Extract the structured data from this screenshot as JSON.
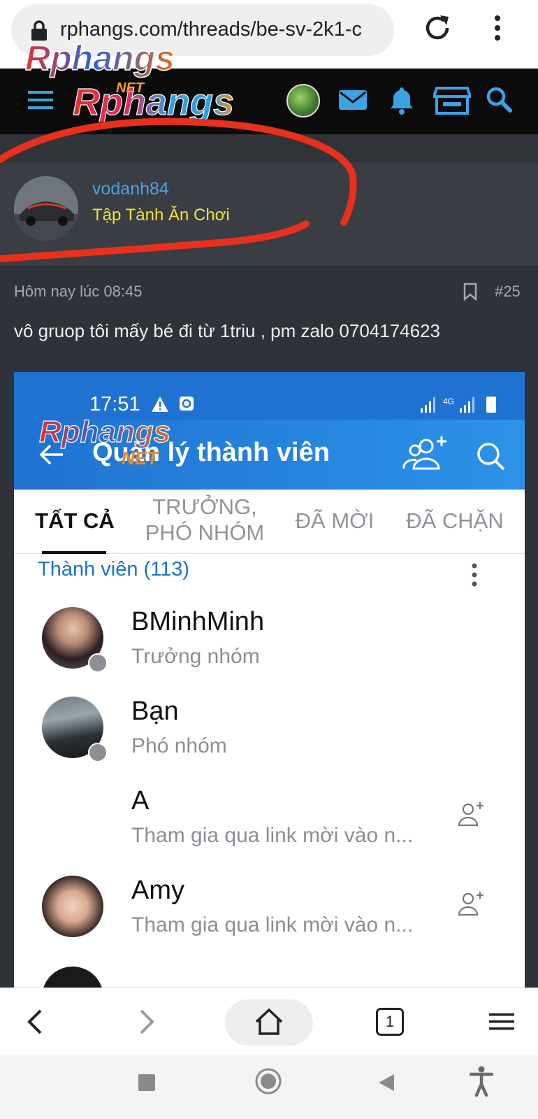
{
  "browser": {
    "url": "rphangs.com/threads/be-sv-2k1-c",
    "icons": [
      "lock-icon",
      "reload-icon",
      "more-vert-icon"
    ]
  },
  "site": {
    "logo_text": "Rphangs",
    "logo_suffix": "NET",
    "header_icons": [
      "menu-icon",
      "user-avatar",
      "mail-icon",
      "bell-icon",
      "store-icon",
      "search-icon"
    ],
    "logo_color": "#e2312a",
    "accent": "#3aa3e3"
  },
  "post": {
    "username": "vodanh84",
    "user_title": "Tập Tành Ăn Chơi",
    "date": "Hôm nay lúc 08:45",
    "number": "#25",
    "body": "vô gruop tôi mấy bé đi từ 1triu , pm zalo 0704174623",
    "annotation_color": "#e8301c"
  },
  "screenshot": {
    "status_time": "17:51",
    "status_network": "4G",
    "title": "Quản lý thành viên",
    "tabs": [
      {
        "label": "TẤT CẢ",
        "active": true
      },
      {
        "label": "TRƯỞNG, PHÓ NHÓM",
        "active": false
      },
      {
        "label": "ĐÃ MỜI",
        "active": false
      },
      {
        "label": "ĐÃ CHẶN",
        "active": false
      }
    ],
    "members_heading": "Thành viên (113)",
    "members": [
      {
        "name": "BMinhMinh",
        "sub": "Trưởng nhóm",
        "has_avatar": true,
        "key_badge": true,
        "add_button": false
      },
      {
        "name": "Bạn",
        "sub": "Phó nhóm",
        "has_avatar": true,
        "key_badge": true,
        "add_button": false
      },
      {
        "name": "A",
        "sub": "Tham gia qua link mời vào n...",
        "has_avatar": false,
        "key_badge": false,
        "add_button": true
      },
      {
        "name": "Amy",
        "sub": "Tham gia qua link mời vào n...",
        "has_avatar": true,
        "key_badge": false,
        "add_button": true
      }
    ],
    "app_color": "#1f72d1"
  },
  "bottom_nav": {
    "tab_count": "1",
    "icons": [
      "back-icon",
      "forward-icon",
      "home-icon",
      "tabs-icon",
      "menu-icon"
    ]
  },
  "system_nav": {
    "icons": [
      "recents-icon",
      "home-circle-icon",
      "back-triangle-icon",
      "accessibility-icon"
    ]
  }
}
